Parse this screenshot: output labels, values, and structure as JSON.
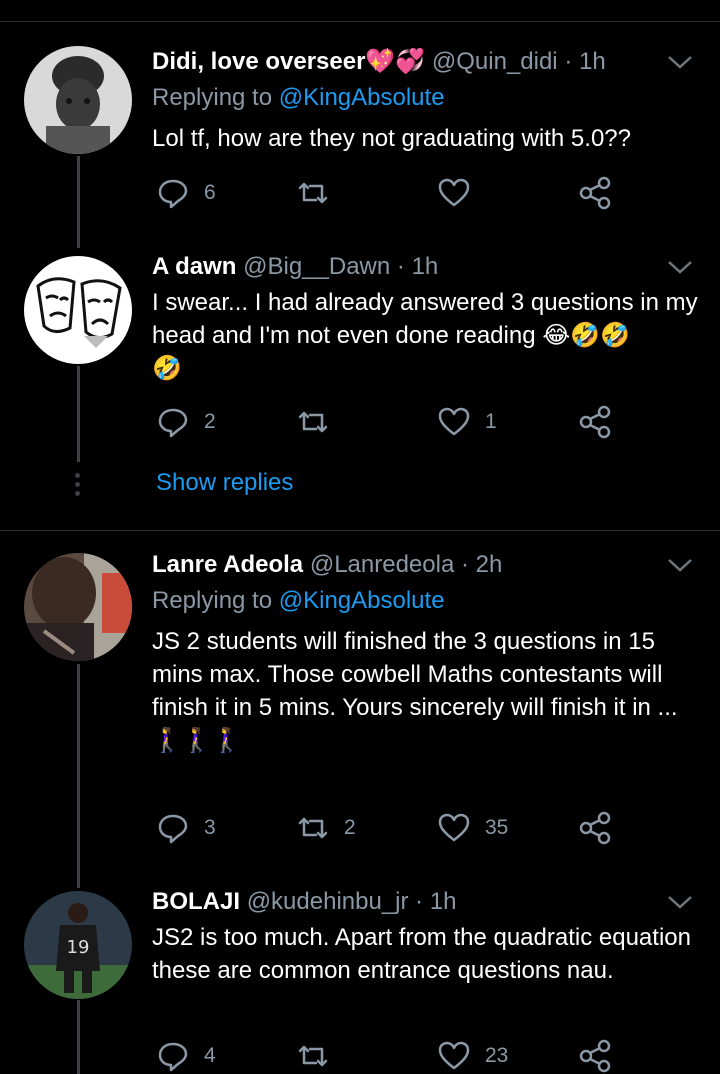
{
  "tweets": [
    {
      "name": "Didi, love overseer💖💞",
      "handle": "@Quin_didi",
      "time": "· 1h",
      "replying_prefix": "Replying to ",
      "replying_to": "@KingAbsolute",
      "text": "Lol tf, how are they not graduating with 5.0??",
      "replies": "6",
      "retweets": "",
      "likes": ""
    },
    {
      "name": "A dawn",
      "handle": "@Big__Dawn",
      "time": "· 1h",
      "text": "I swear... I had already answered 3 questions in my head and I'm not even done reading 😂🤣🤣",
      "text_tail": "🤣",
      "replies": "2",
      "retweets": "",
      "likes": "1"
    },
    {
      "name": "Lanre Adeola",
      "handle": "@Lanredeola",
      "time": "· 2h",
      "replying_prefix": "Replying to ",
      "replying_to": "@KingAbsolute",
      "text": "JS 2 students will finished the 3 questions in 15 mins max. Those cowbell Maths contestants will finish it in 5 mins. Yours sincerely will finish it in ...",
      "text_tail": "🚶‍♀️🚶‍♀️🚶‍♀️",
      "replies": "3",
      "retweets": "2",
      "likes": "35"
    },
    {
      "name": "BOLAJI",
      "handle": "@kudehinbu_jr",
      "time": "· 1h",
      "text": "JS2 is too much. Apart from the quadratic equation these are common entrance questions nau.",
      "replies": "4",
      "retweets": "",
      "likes": "23"
    }
  ],
  "show_replies": "Show replies",
  "avatar_jersey_number": "19",
  "colors": {
    "link": "#1d9bf0",
    "muted": "#8b98a5",
    "background": "#000000"
  }
}
